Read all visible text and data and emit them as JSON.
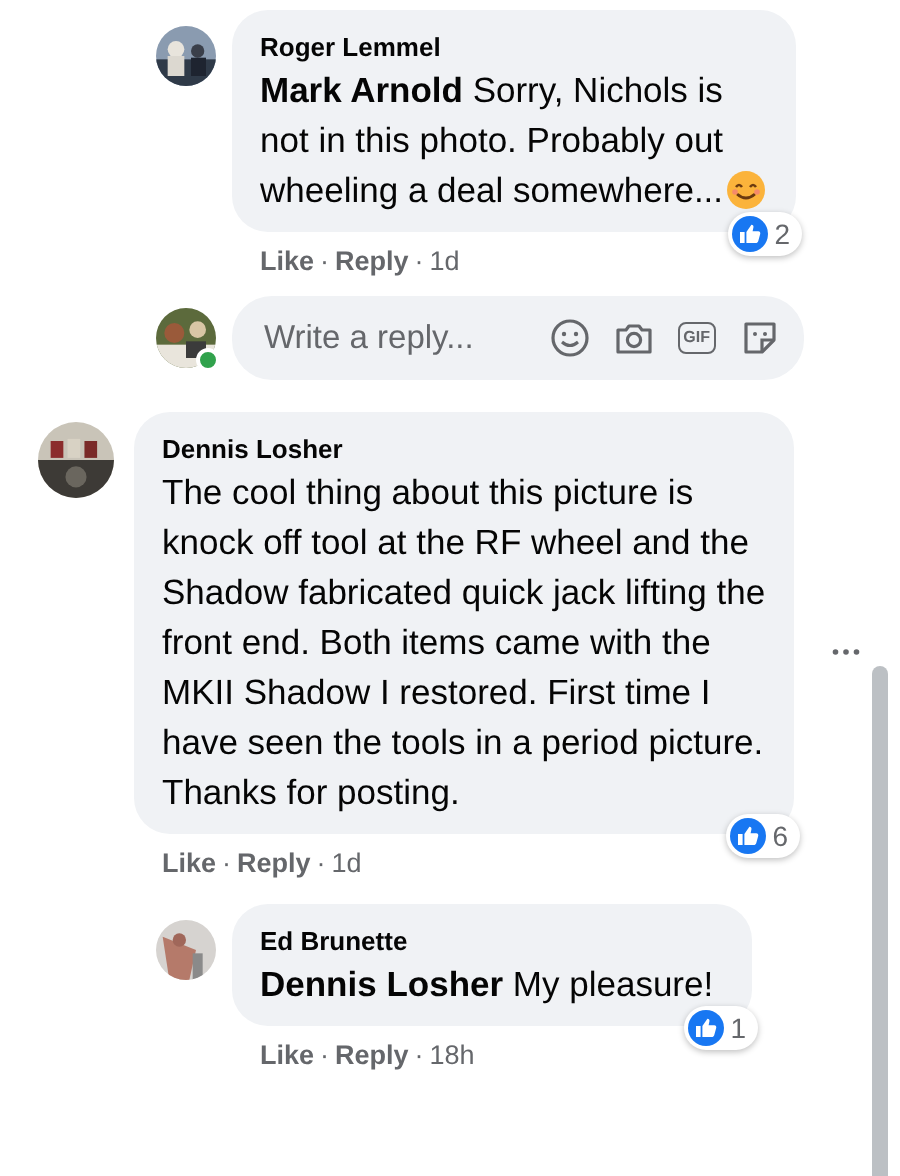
{
  "earlier_replies": [
    {
      "author": "Roger Lemmel",
      "text": "**Mark Arnold** Sorry, Nichols is not in this photo. Probably out wheeling a deal somewhere...",
      "likes": "2",
      "actions": [
        {
          "kind": "link",
          "text": "Like"
        },
        {
          "kind": "sep",
          "text": "·"
        },
        {
          "kind": "link",
          "text": "Reply"
        },
        {
          "kind": "sep",
          "text": "·"
        },
        {
          "kind": "time",
          "text": "1d"
        }
      ]
    }
  ],
  "reply_box": {
    "placeholder": "Write a reply...",
    "online": true,
    "gif_label": "GIF"
  },
  "comments": [
    {
      "author": "Dennis Losher",
      "text": "The cool thing about this picture is knock off tool at the RF wheel and the Shadow fabricated quick jack lifting the front end. Both items came with the MKII Shadow I restored. First time I have seen the tools in a period picture. Thanks for posting.",
      "likes": "6",
      "actions": [
        {
          "kind": "link",
          "text": "Like"
        },
        {
          "kind": "sep",
          "text": "·"
        },
        {
          "kind": "link",
          "text": "Reply"
        },
        {
          "kind": "sep",
          "text": "·"
        },
        {
          "kind": "time",
          "text": "1d"
        }
      ],
      "menu": true,
      "replies": [
        {
          "author": "Ed Brunette",
          "text": "**Dennis Losher** My pleasure!",
          "likes": "1",
          "actions": [
            {
              "kind": "link",
              "text": "Like"
            },
            {
              "kind": "sep",
              "text": "·"
            },
            {
              "kind": "link",
              "text": "Reply"
            },
            {
              "kind": "sep",
              "text": "·"
            },
            {
              "kind": "time",
              "text": "18h"
            }
          ]
        }
      ]
    }
  ]
}
